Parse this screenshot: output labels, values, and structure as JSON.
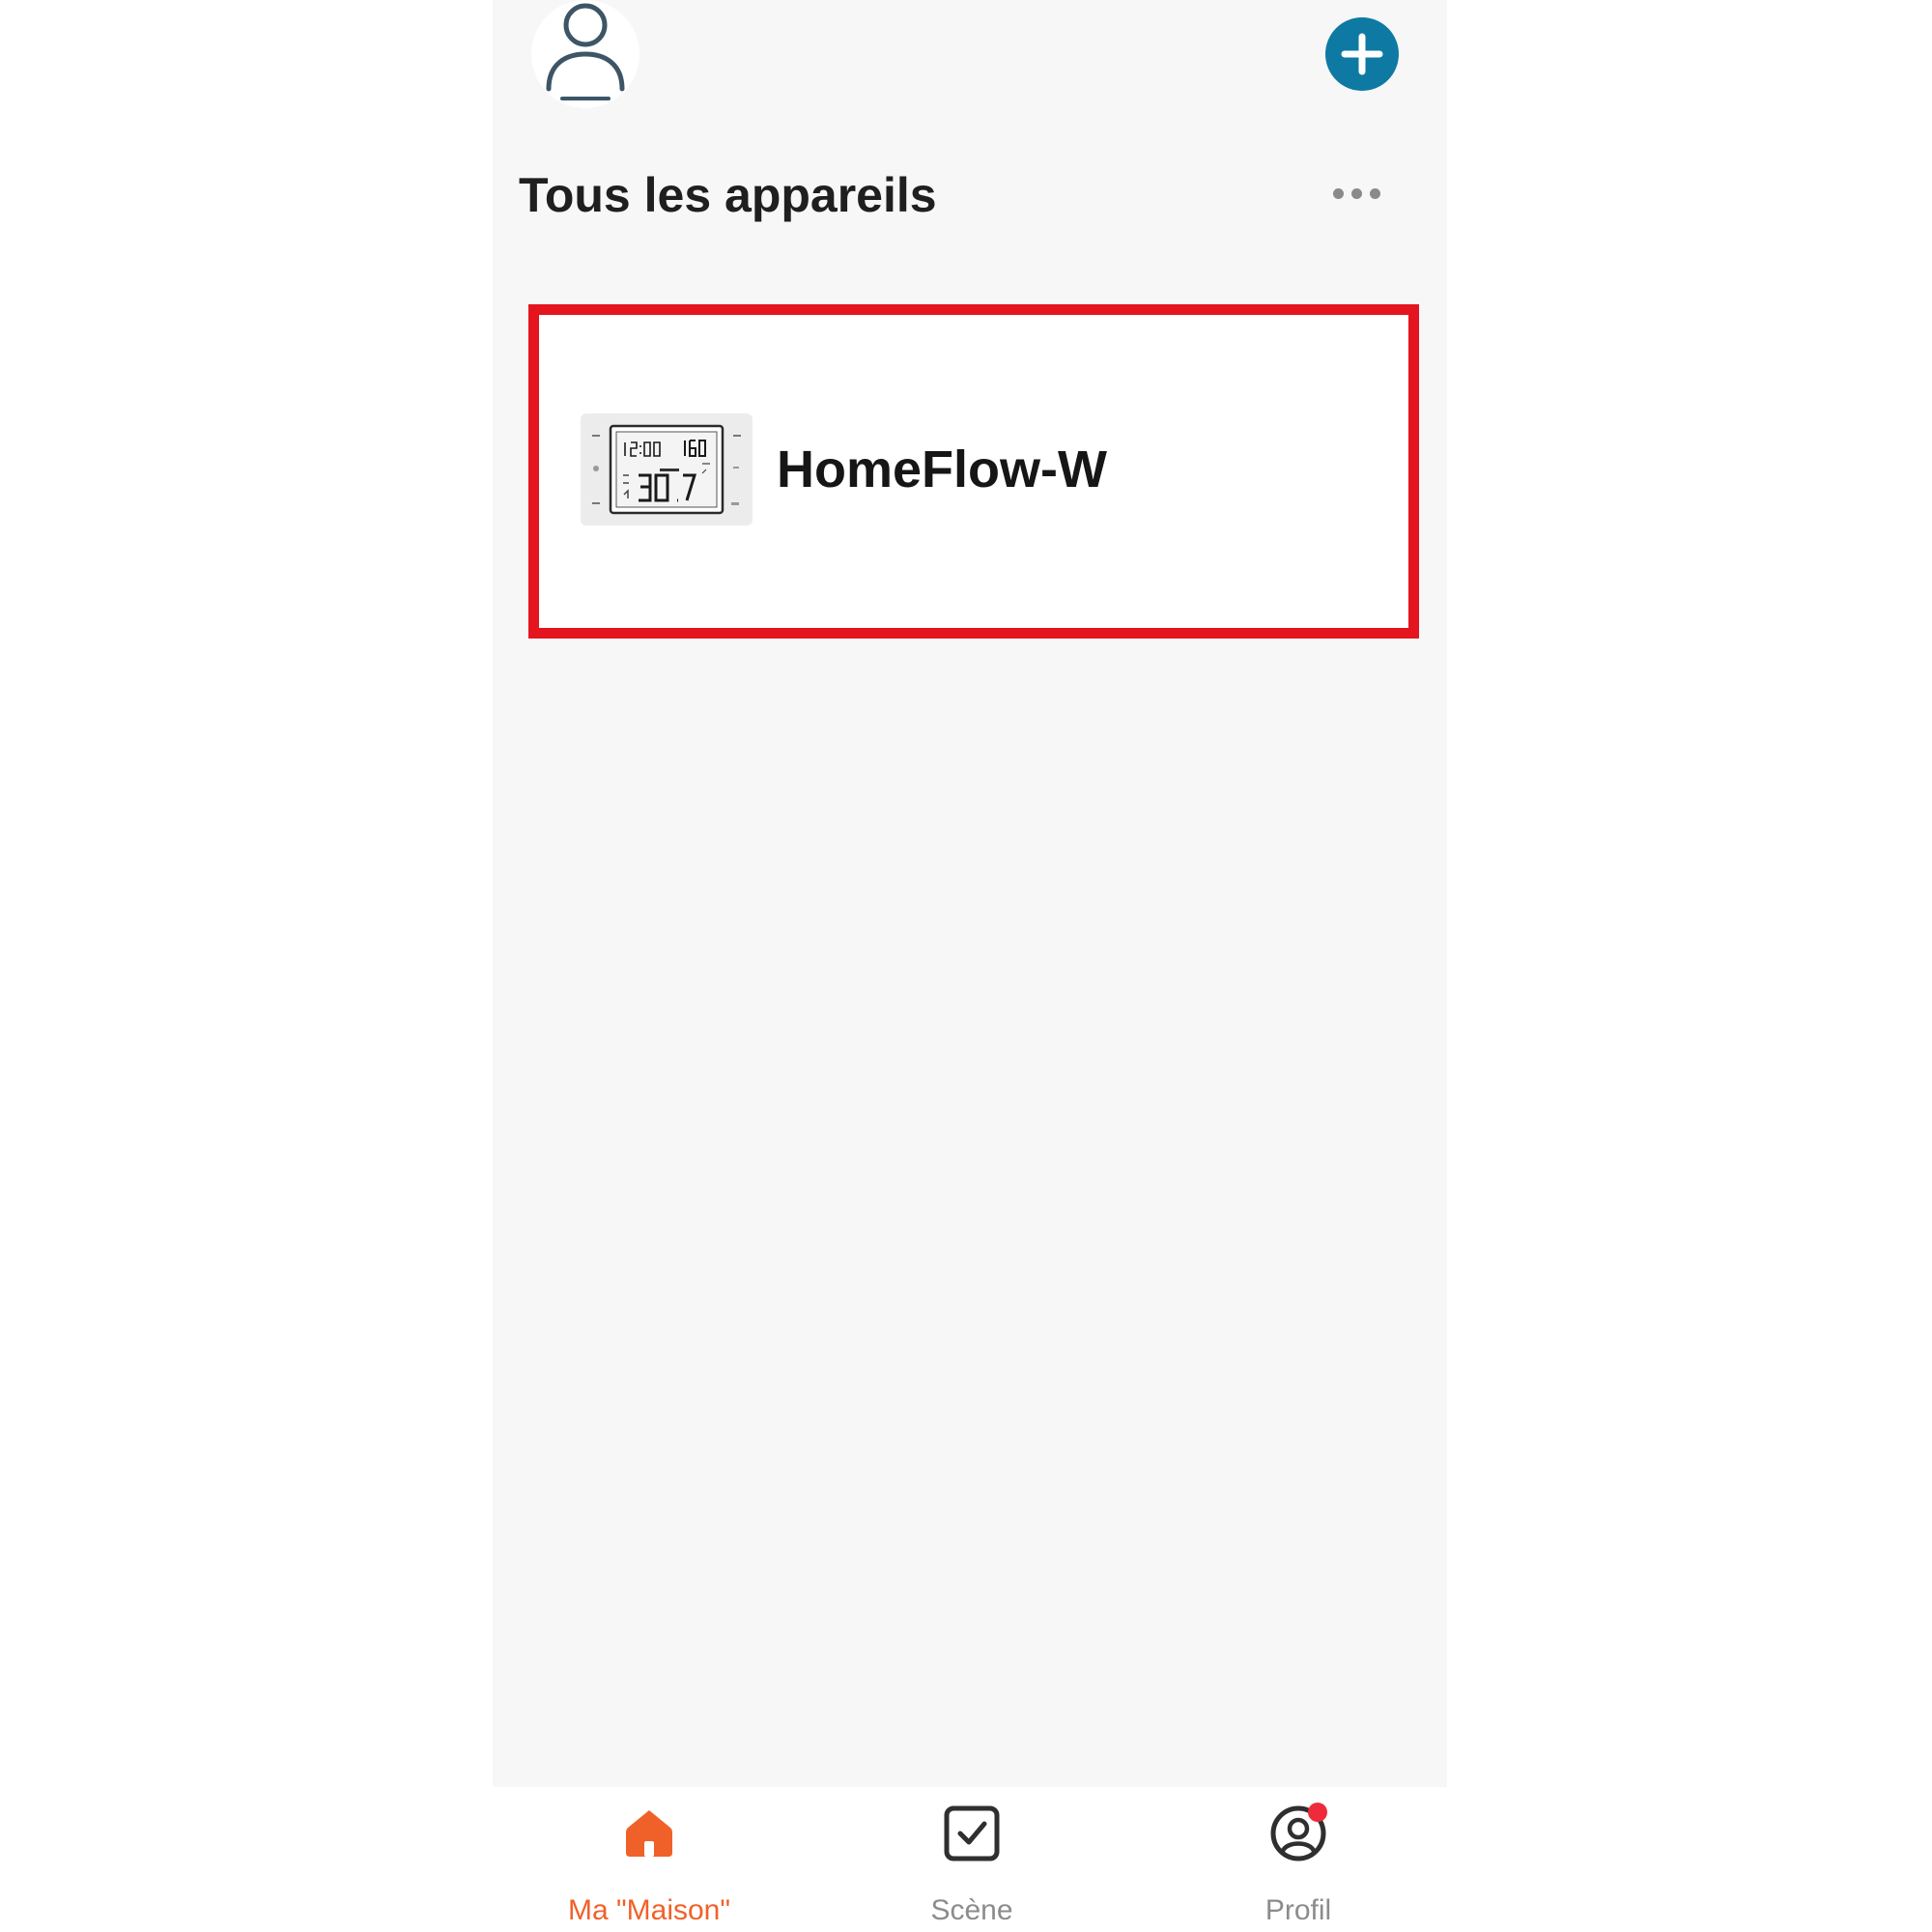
{
  "header": {
    "avatar_icon": "user-outline-icon",
    "add_icon": "plus-circle-icon",
    "add_color": "#0e7aa3"
  },
  "main": {
    "title": "Tous les appareils",
    "more_icon": "more-horizontal-icon",
    "devices": [
      {
        "name": "HomeFlow-W",
        "thumbnail_icon": "thermostat-lcd-icon",
        "highlight_color": "#e4151f"
      }
    ]
  },
  "bottom_nav": {
    "items": [
      {
        "label": "Ma \"Maison\"",
        "icon": "home-icon",
        "active": true,
        "color": "#f0612a"
      },
      {
        "label": "Scène",
        "icon": "checkbox-icon",
        "active": false
      },
      {
        "label": "Profil",
        "icon": "profile-icon",
        "active": false,
        "has_notification": true,
        "badge_color": "#ee2b3a"
      }
    ]
  }
}
